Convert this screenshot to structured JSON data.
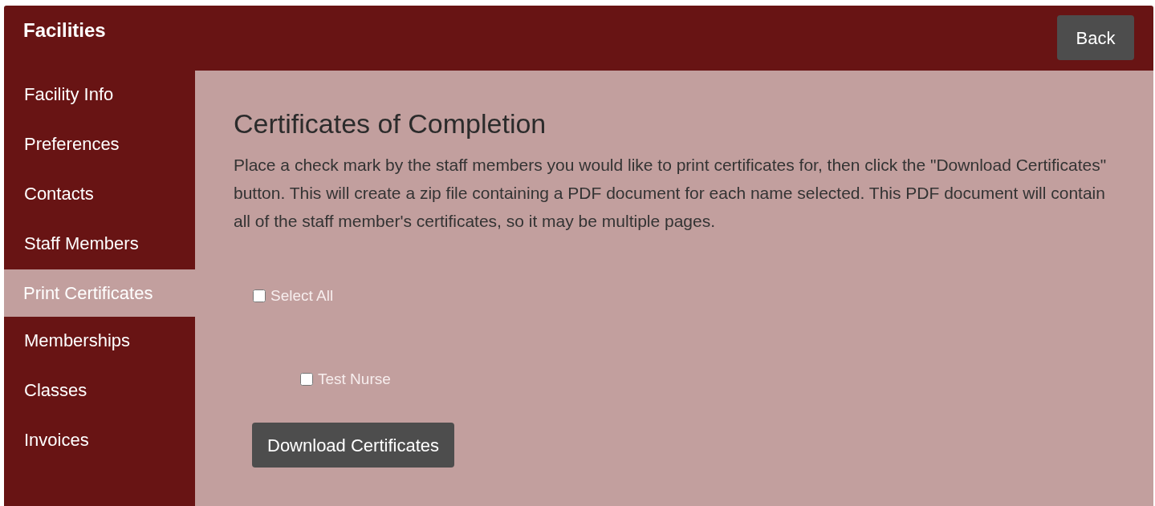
{
  "header": {
    "title": "Facilities",
    "back_button": "Back"
  },
  "sidebar": {
    "items": [
      {
        "label": "Facility Info",
        "selected": false
      },
      {
        "label": "Preferences",
        "selected": false
      },
      {
        "label": "Contacts",
        "selected": false
      },
      {
        "label": "Staff Members",
        "selected": false
      },
      {
        "label": "Print Certificates",
        "selected": true
      },
      {
        "label": "Memberships",
        "selected": false
      },
      {
        "label": "Classes",
        "selected": false
      },
      {
        "label": "Invoices",
        "selected": false
      }
    ]
  },
  "content": {
    "title": "Certificates of Completion",
    "description": "Place a check mark by the staff members you would like to print certificates for, then click the \"Download Certificates\" button. This will create a zip file containing a PDF document for each name selected. This PDF document will contain all of the staff member's certificates, so it may be multiple pages.",
    "select_all": {
      "label": "Select All",
      "checked": false
    },
    "staff": [
      {
        "label": "Test Nurse",
        "checked": false
      }
    ],
    "download_button": "Download Certificates"
  }
}
